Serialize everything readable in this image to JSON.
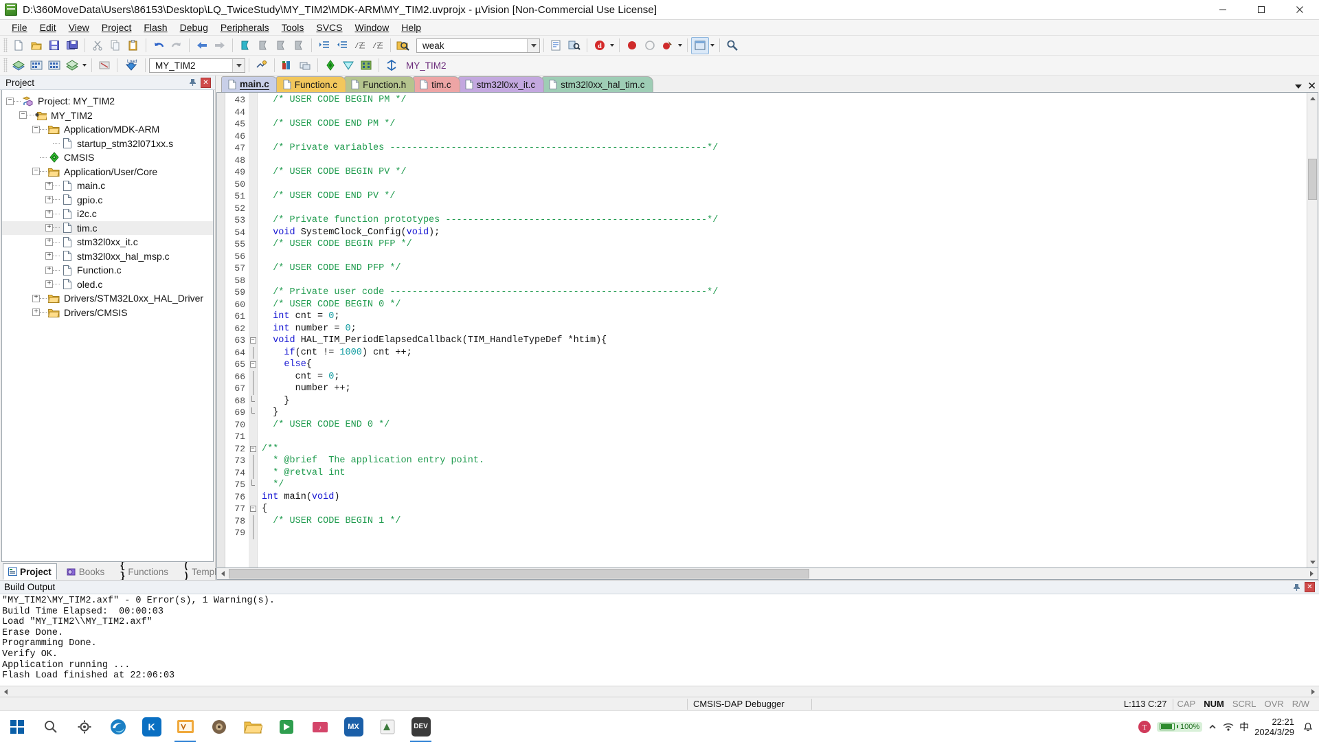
{
  "window": {
    "title": "D:\\360MoveData\\Users\\86153\\Desktop\\LQ_TwiceStudy\\MY_TIM2\\MDK-ARM\\MY_TIM2.uvprojx - µVision  [Non-Commercial Use License]",
    "minimize_label": "—",
    "maximize_label": "❐",
    "close_label": "✕",
    "app_icon": "uvision-icon"
  },
  "menu": {
    "items": [
      {
        "label": "File",
        "accel": "F"
      },
      {
        "label": "Edit",
        "accel": "E"
      },
      {
        "label": "View",
        "accel": "V"
      },
      {
        "label": "Project",
        "accel": "P"
      },
      {
        "label": "Flash",
        "accel": "l"
      },
      {
        "label": "Debug",
        "accel": "D"
      },
      {
        "label": "Peripherals",
        "accel": "r"
      },
      {
        "label": "Tools",
        "accel": "T"
      },
      {
        "label": "SVCS",
        "accel": "S"
      },
      {
        "label": "Window",
        "accel": "W"
      },
      {
        "label": "Help",
        "accel": "H"
      }
    ]
  },
  "toolbar1": {
    "icons": [
      "new-file-icon",
      "open-file-icon",
      "save-icon",
      "save-all-icon",
      "cut-icon",
      "copy-icon",
      "paste-icon",
      "undo-icon",
      "redo-icon",
      "navigate-back-icon",
      "navigate-forward-icon",
      "bookmark-toggle-icon",
      "bookmark-prev-icon",
      "bookmark-next-icon",
      "bookmark-clear-icon",
      "indent-icon",
      "outdent-icon",
      "comment-icon",
      "uncomment-icon",
      "find-in-files-icon"
    ],
    "search_box_value": "weak",
    "search_box_placeholder": "",
    "right_icons": [
      "text-find-icon",
      "find-next-icon",
      "debug-session-icon",
      "insert-breakpoint-icon",
      "disable-breakpoint-icon",
      "kill-breakpoints-icon",
      "window-layout-icon",
      "configuration-wizard-icon"
    ]
  },
  "toolbar2": {
    "icons": [
      "translate-icon",
      "build-icon",
      "rebuild-icon",
      "batch-build-icon",
      "stop-build-icon",
      "download-icon"
    ],
    "download_label": "Load",
    "target_value": "MY_TIM2",
    "right_icons": [
      "target-options-icon",
      "manage-project-items-icon",
      "multi-project-icon",
      "pack-installer-icon",
      "manage-runtime-env-icon",
      "select-software-packs-icon"
    ]
  },
  "project_panel": {
    "title": "Project",
    "pin_icon": "pin-icon",
    "close_icon": "close-icon",
    "tree": [
      {
        "label": "Project: MY_TIM2",
        "depth": 0,
        "expander": "minus",
        "icon": "project-icon",
        "selected": false
      },
      {
        "label": "MY_TIM2",
        "depth": 1,
        "expander": "minus",
        "icon": "target-folder-icon",
        "selected": false
      },
      {
        "label": "Application/MDK-ARM",
        "depth": 2,
        "expander": "minus",
        "icon": "folder-icon",
        "selected": false
      },
      {
        "label": "startup_stm32l071xx.s",
        "depth": 3,
        "expander": "none",
        "icon": "file-icon",
        "selected": false
      },
      {
        "label": "CMSIS",
        "depth": 2,
        "expander": "none",
        "icon": "cmsis-icon",
        "selected": false
      },
      {
        "label": "Application/User/Core",
        "depth": 2,
        "expander": "minus",
        "icon": "folder-icon",
        "selected": false
      },
      {
        "label": "main.c",
        "depth": 3,
        "expander": "plus",
        "icon": "file-icon",
        "selected": false
      },
      {
        "label": "gpio.c",
        "depth": 3,
        "expander": "plus",
        "icon": "file-icon",
        "selected": false
      },
      {
        "label": "i2c.c",
        "depth": 3,
        "expander": "plus",
        "icon": "file-icon",
        "selected": false
      },
      {
        "label": "tim.c",
        "depth": 3,
        "expander": "plus",
        "icon": "file-icon",
        "selected": true
      },
      {
        "label": "stm32l0xx_it.c",
        "depth": 3,
        "expander": "plus",
        "icon": "file-icon",
        "selected": false
      },
      {
        "label": "stm32l0xx_hal_msp.c",
        "depth": 3,
        "expander": "plus",
        "icon": "file-icon",
        "selected": false
      },
      {
        "label": "Function.c",
        "depth": 3,
        "expander": "plus",
        "icon": "file-icon",
        "selected": false
      },
      {
        "label": "oled.c",
        "depth": 3,
        "expander": "plus",
        "icon": "file-icon",
        "selected": false
      },
      {
        "label": "Drivers/STM32L0xx_HAL_Driver",
        "depth": 2,
        "expander": "plus",
        "icon": "folder-icon",
        "selected": false
      },
      {
        "label": "Drivers/CMSIS",
        "depth": 2,
        "expander": "plus",
        "icon": "folder-icon",
        "selected": false
      }
    ],
    "tabs": [
      {
        "label": "Project",
        "icon": "project-tab-icon",
        "active": true
      },
      {
        "label": "Books",
        "icon": "books-tab-icon",
        "active": false
      },
      {
        "label": "Functions",
        "icon": "functions-tab-icon",
        "active": false
      },
      {
        "label": "Templates",
        "icon": "templates-tab-icon",
        "active": false
      }
    ]
  },
  "editor": {
    "tabs": [
      {
        "label": "main.c",
        "color": "#c8cfe8",
        "active": true
      },
      {
        "label": "Function.c",
        "color": "#f2c75c",
        "active": false
      },
      {
        "label": "Function.h",
        "color": "#b5c48e",
        "active": false
      },
      {
        "label": "tim.c",
        "color": "#eda5a5",
        "active": false
      },
      {
        "label": "stm32l0xx_it.c",
        "color": "#c3a8df",
        "active": false
      },
      {
        "label": "stm32l0xx_hal_tim.c",
        "color": "#9ecdb5",
        "active": false
      }
    ],
    "tabstrip_buttons": [
      "tab-list-caret-icon",
      "close-document-icon"
    ],
    "first_line_number": 43,
    "lines": [
      {
        "n": 43,
        "fold": "",
        "tokens": [
          {
            "t": "  ",
            "c": "pn"
          },
          {
            "t": "/* USER CODE BEGIN PM */",
            "c": "cm"
          }
        ]
      },
      {
        "n": 44,
        "fold": "",
        "tokens": []
      },
      {
        "n": 45,
        "fold": "",
        "tokens": [
          {
            "t": "  ",
            "c": "pn"
          },
          {
            "t": "/* USER CODE END PM */",
            "c": "cm"
          }
        ]
      },
      {
        "n": 46,
        "fold": "",
        "tokens": []
      },
      {
        "n": 47,
        "fold": "",
        "tokens": [
          {
            "t": "  ",
            "c": "pn"
          },
          {
            "t": "/* Private variables ---------------------------------------------------------*/",
            "c": "cm"
          }
        ]
      },
      {
        "n": 48,
        "fold": "",
        "tokens": []
      },
      {
        "n": 49,
        "fold": "",
        "tokens": [
          {
            "t": "  ",
            "c": "pn"
          },
          {
            "t": "/* USER CODE BEGIN PV */",
            "c": "cm"
          }
        ]
      },
      {
        "n": 50,
        "fold": "",
        "tokens": []
      },
      {
        "n": 51,
        "fold": "",
        "tokens": [
          {
            "t": "  ",
            "c": "pn"
          },
          {
            "t": "/* USER CODE END PV */",
            "c": "cm"
          }
        ]
      },
      {
        "n": 52,
        "fold": "",
        "tokens": []
      },
      {
        "n": 53,
        "fold": "",
        "tokens": [
          {
            "t": "  ",
            "c": "pn"
          },
          {
            "t": "/* Private function prototypes -----------------------------------------------*/",
            "c": "cm"
          }
        ]
      },
      {
        "n": 54,
        "fold": "",
        "tokens": [
          {
            "t": "  ",
            "c": "pn"
          },
          {
            "t": "void",
            "c": "kw"
          },
          {
            "t": " SystemClock_Config(",
            "c": "pn"
          },
          {
            "t": "void",
            "c": "kw"
          },
          {
            "t": ");",
            "c": "pn"
          }
        ]
      },
      {
        "n": 55,
        "fold": "",
        "tokens": [
          {
            "t": "  ",
            "c": "pn"
          },
          {
            "t": "/* USER CODE BEGIN PFP */",
            "c": "cm"
          }
        ]
      },
      {
        "n": 56,
        "fold": "",
        "tokens": []
      },
      {
        "n": 57,
        "fold": "",
        "tokens": [
          {
            "t": "  ",
            "c": "pn"
          },
          {
            "t": "/* USER CODE END PFP */",
            "c": "cm"
          }
        ]
      },
      {
        "n": 58,
        "fold": "",
        "tokens": []
      },
      {
        "n": 59,
        "fold": "",
        "tokens": [
          {
            "t": "  ",
            "c": "pn"
          },
          {
            "t": "/* Private user code ---------------------------------------------------------*/",
            "c": "cm"
          }
        ]
      },
      {
        "n": 60,
        "fold": "",
        "tokens": [
          {
            "t": "  ",
            "c": "pn"
          },
          {
            "t": "/* USER CODE BEGIN 0 */",
            "c": "cm"
          }
        ]
      },
      {
        "n": 61,
        "fold": "",
        "tokens": [
          {
            "t": "  ",
            "c": "pn"
          },
          {
            "t": "int",
            "c": "kw"
          },
          {
            "t": " cnt = ",
            "c": "pn"
          },
          {
            "t": "0",
            "c": "nb"
          },
          {
            "t": ";",
            "c": "pn"
          }
        ]
      },
      {
        "n": 62,
        "fold": "",
        "tokens": [
          {
            "t": "  ",
            "c": "pn"
          },
          {
            "t": "int",
            "c": "kw"
          },
          {
            "t": " number = ",
            "c": "pn"
          },
          {
            "t": "0",
            "c": "nb"
          },
          {
            "t": ";",
            "c": "pn"
          }
        ]
      },
      {
        "n": 63,
        "fold": "minus",
        "tokens": [
          {
            "t": "  ",
            "c": "pn"
          },
          {
            "t": "void",
            "c": "kw"
          },
          {
            "t": " HAL_TIM_PeriodElapsedCallback(TIM_HandleTypeDef *htim){",
            "c": "pn"
          }
        ]
      },
      {
        "n": 64,
        "fold": "bar",
        "tokens": [
          {
            "t": "    ",
            "c": "pn"
          },
          {
            "t": "if",
            "c": "kw"
          },
          {
            "t": "(cnt != ",
            "c": "pn"
          },
          {
            "t": "1000",
            "c": "nb"
          },
          {
            "t": ") cnt ++;",
            "c": "pn"
          }
        ]
      },
      {
        "n": 65,
        "fold": "minus",
        "tokens": [
          {
            "t": "    ",
            "c": "pn"
          },
          {
            "t": "else",
            "c": "kw"
          },
          {
            "t": "{",
            "c": "pn"
          }
        ]
      },
      {
        "n": 66,
        "fold": "bar2",
        "tokens": [
          {
            "t": "      cnt = ",
            "c": "pn"
          },
          {
            "t": "0",
            "c": "nb"
          },
          {
            "t": ";",
            "c": "pn"
          }
        ]
      },
      {
        "n": 67,
        "fold": "bar2",
        "tokens": [
          {
            "t": "      number ++;",
            "c": "pn"
          }
        ]
      },
      {
        "n": 68,
        "fold": "end2",
        "tokens": [
          {
            "t": "    }",
            "c": "pn"
          }
        ]
      },
      {
        "n": 69,
        "fold": "end",
        "tokens": [
          {
            "t": "  }",
            "c": "pn"
          }
        ]
      },
      {
        "n": 70,
        "fold": "",
        "tokens": [
          {
            "t": "  ",
            "c": "pn"
          },
          {
            "t": "/* USER CODE END 0 */",
            "c": "cm"
          }
        ]
      },
      {
        "n": 71,
        "fold": "",
        "tokens": []
      },
      {
        "n": 72,
        "fold": "minus",
        "tokens": [
          {
            "t": "/**",
            "c": "cm"
          }
        ]
      },
      {
        "n": 73,
        "fold": "bar",
        "tokens": [
          {
            "t": "  * @brief  The application entry point.",
            "c": "cm"
          }
        ]
      },
      {
        "n": 74,
        "fold": "bar",
        "tokens": [
          {
            "t": "  * @retval int",
            "c": "cm"
          }
        ]
      },
      {
        "n": 75,
        "fold": "end",
        "tokens": [
          {
            "t": "  */",
            "c": "cm"
          }
        ]
      },
      {
        "n": 76,
        "fold": "",
        "tokens": [
          {
            "t": "int",
            "c": "kw"
          },
          {
            "t": " main(",
            "c": "pn"
          },
          {
            "t": "void",
            "c": "kw"
          },
          {
            "t": ")",
            "c": "pn"
          }
        ]
      },
      {
        "n": 77,
        "fold": "minus",
        "tokens": [
          {
            "t": "{",
            "c": "pn"
          }
        ]
      },
      {
        "n": 78,
        "fold": "bar",
        "tokens": [
          {
            "t": "  ",
            "c": "pn"
          },
          {
            "t": "/* USER CODE BEGIN 1 */",
            "c": "cm"
          }
        ]
      },
      {
        "n": 79,
        "fold": "bar",
        "tokens": []
      }
    ]
  },
  "build_output": {
    "title": "Build Output",
    "pin_icon": "pin-icon",
    "close_icon": "close-icon",
    "text": "\"MY_TIM2\\MY_TIM2.axf\" - 0 Error(s), 1 Warning(s).\nBuild Time Elapsed:  00:00:03\nLoad \"MY_TIM2\\\\MY_TIM2.axf\"\nErase Done.\nProgramming Done.\nVerify OK.\nApplication running ...\nFlash Load finished at 22:06:03"
  },
  "statusbar": {
    "debugger": "CMSIS-DAP Debugger",
    "position": "L:113 C:27",
    "flags": [
      {
        "label": "CAP",
        "on": false
      },
      {
        "label": "NUM",
        "on": true
      },
      {
        "label": "SCRL",
        "on": false
      },
      {
        "label": "OVR",
        "on": false
      },
      {
        "label": "R/W",
        "on": false
      }
    ]
  },
  "taskbar": {
    "items": [
      {
        "name": "start-button",
        "icon": "windows-logo-icon",
        "label": "",
        "color": "#0078d7",
        "active": false
      },
      {
        "name": "search-button",
        "icon": "search-icon",
        "label": "",
        "color": "#666666",
        "active": false
      },
      {
        "name": "settings-button",
        "icon": "gear-icon",
        "label": "",
        "color": "#555555",
        "active": false
      },
      {
        "name": "edge-button",
        "icon": "edge-icon",
        "label": "",
        "color": "#0d7ec4",
        "active": false
      },
      {
        "name": "keil-button",
        "icon": "keil-icon",
        "label": "K",
        "color": "#0a6fc2",
        "active": false
      },
      {
        "name": "uvision-button",
        "icon": "uvision-icon",
        "label": "",
        "color": "#e8a33d",
        "active": true
      },
      {
        "name": "app-7-button",
        "icon": "app-icon",
        "label": "",
        "color": "#6b5a45",
        "active": false
      },
      {
        "name": "explorer-button",
        "icon": "folder-icon",
        "label": "",
        "color": "#e8b339",
        "active": false
      },
      {
        "name": "app-9-button",
        "icon": "app-icon",
        "label": "",
        "color": "#2f9e4f",
        "active": false
      },
      {
        "name": "app-10-button",
        "icon": "app-icon",
        "label": "",
        "color": "#d4456a",
        "active": false
      },
      {
        "name": "mx-button",
        "icon": "cubemx-icon",
        "label": "MX",
        "color": "#1b5fa8",
        "active": false
      },
      {
        "name": "app-12-button",
        "icon": "app-icon",
        "label": "",
        "color": "#3c7a3c",
        "active": false
      },
      {
        "name": "dev-button",
        "icon": "dev-icon",
        "label": "DEV",
        "color": "#3a3a3a",
        "active": true
      }
    ],
    "tray": {
      "battery_percent": "100%",
      "ime_label": "中",
      "show_hidden_icon": "chevron-up-icon",
      "clock_time": "22:21",
      "clock_date": "2024/3/29",
      "notification_icon": "notification-icon"
    }
  }
}
